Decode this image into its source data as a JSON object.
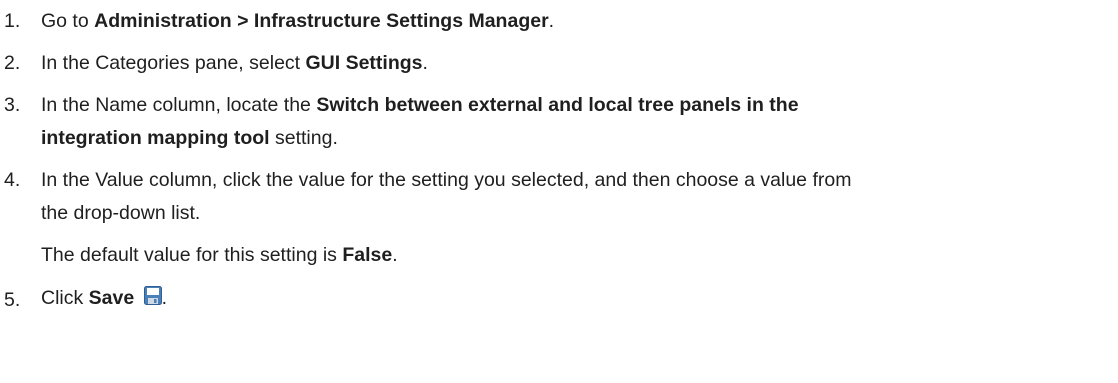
{
  "steps": [
    {
      "number": "1.",
      "lines": [
        [
          {
            "text": "Go to ",
            "bold": false
          },
          {
            "text": "Administration > Infrastructure Settings Manager",
            "bold": true
          },
          {
            "text": ".",
            "bold": false
          }
        ]
      ]
    },
    {
      "number": "2.",
      "lines": [
        [
          {
            "text": "In the Categories pane, select ",
            "bold": false
          },
          {
            "text": "GUI Settings",
            "bold": true
          },
          {
            "text": ".",
            "bold": false
          }
        ]
      ]
    },
    {
      "number": "3.",
      "lines": [
        [
          {
            "text": "In the Name column, locate the ",
            "bold": false
          },
          {
            "text": "Switch between external and local tree panels in the",
            "bold": true
          }
        ],
        [
          {
            "text": "integration mapping tool",
            "bold": true
          },
          {
            "text": " setting.",
            "bold": false
          }
        ]
      ]
    },
    {
      "number": "4.",
      "lines": [
        [
          {
            "text": "In the Value column, click the value for the setting you selected, and then choose a value from",
            "bold": false
          }
        ],
        [
          {
            "text": "the drop-down list.",
            "bold": false
          }
        ]
      ]
    },
    {
      "number": "",
      "lines": [
        [
          {
            "text": "The default value for this setting is ",
            "bold": false
          },
          {
            "text": "False",
            "bold": true
          },
          {
            "text": ".",
            "bold": false
          }
        ]
      ]
    },
    {
      "number": "5.",
      "lines": [
        [
          {
            "text": "Click ",
            "bold": false
          },
          {
            "text": "Save",
            "bold": true
          },
          {
            "icon": "save-icon"
          },
          {
            "text": ".",
            "bold": false
          }
        ]
      ]
    }
  ],
  "icon_colors": {
    "save_body": "#4a7fb8",
    "save_label": "#ffffff",
    "save_shutter": "#cfd9e6"
  }
}
